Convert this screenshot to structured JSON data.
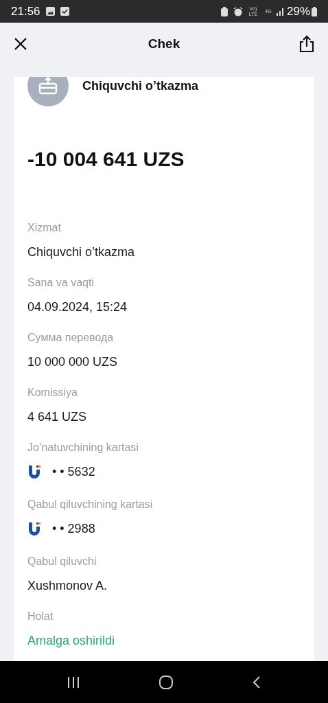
{
  "status_bar": {
    "time": "21:56",
    "network": [
      "Vo) LTE",
      "4G"
    ],
    "battery": "29%"
  },
  "header": {
    "title": "Chek"
  },
  "receipt": {
    "type": "Chiquvchi o’tkazma",
    "amount": "-10 004 641 UZS",
    "fields": [
      {
        "kind": "text",
        "label": "Xizmat",
        "value": "Chiquvchi o’tkazma"
      },
      {
        "kind": "text",
        "label": "Sana va vaqti",
        "value": "04.09.2024, 15:24"
      },
      {
        "kind": "text",
        "label": "Сумма перевода",
        "value": "10 000 000 UZS"
      },
      {
        "kind": "text",
        "label": "Komissiya",
        "value": "4 641 UZS"
      },
      {
        "kind": "card",
        "label": "Jo’natuvchining kartasi",
        "value": "• • 5632"
      },
      {
        "kind": "card",
        "label": "Qabul qiluvchining kartasi",
        "value": "• • 2988"
      },
      {
        "kind": "text",
        "label": "Qabul qiluvchi",
        "value": "Xushmonov A."
      },
      {
        "kind": "status",
        "label": "Holat",
        "value": "Amalga oshirildi",
        "color": "#2aa876"
      }
    ]
  }
}
